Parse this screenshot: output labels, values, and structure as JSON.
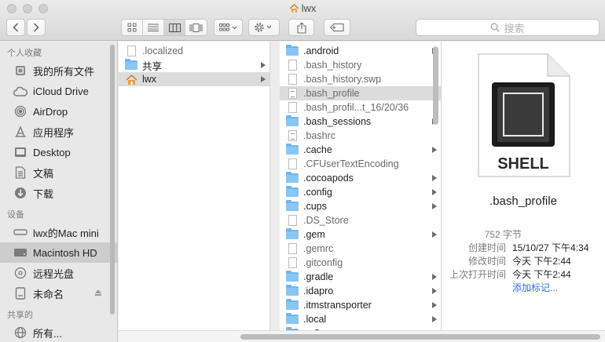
{
  "window": {
    "title": "lwx"
  },
  "toolbar": {
    "search_placeholder": "搜索"
  },
  "sidebar": {
    "sections": [
      {
        "heading": "个人收藏",
        "items": [
          {
            "label": "我的所有文件",
            "icon": "all-files-icon"
          },
          {
            "label": "iCloud Drive",
            "icon": "cloud-icon"
          },
          {
            "label": "AirDrop",
            "icon": "airdrop-icon"
          },
          {
            "label": "应用程序",
            "icon": "applications-icon"
          },
          {
            "label": "Desktop",
            "icon": "desktop-icon"
          },
          {
            "label": "文稿",
            "icon": "documents-icon"
          },
          {
            "label": "下载",
            "icon": "downloads-icon"
          }
        ]
      },
      {
        "heading": "设备",
        "items": [
          {
            "label": "lwx的Mac mini",
            "icon": "computer-icon"
          },
          {
            "label": "Macintosh HD",
            "icon": "harddisk-icon",
            "selected": true
          },
          {
            "label": "远程光盘",
            "icon": "disc-icon"
          },
          {
            "label": "未命名",
            "icon": "drive-icon",
            "eject": true
          }
        ]
      },
      {
        "heading": "共享的",
        "items": [
          {
            "label": "所有...",
            "icon": "network-icon"
          }
        ]
      }
    ]
  },
  "column1": [
    {
      "name": ".localized",
      "type": "doc"
    },
    {
      "name": "共享",
      "type": "folder",
      "arrow": true
    },
    {
      "name": "lwx",
      "type": "home",
      "arrow": true,
      "selected": true
    }
  ],
  "column2": [
    {
      "name": ".android",
      "type": "folder",
      "arrow": true
    },
    {
      "name": ".bash_history",
      "type": "doc"
    },
    {
      "name": ".bash_history.swp",
      "type": "doc"
    },
    {
      "name": ".bash_profile",
      "type": "txt",
      "selected": true
    },
    {
      "name": ".bash_profil...t_16/20/36",
      "type": "doc"
    },
    {
      "name": ".bash_sessions",
      "type": "folder",
      "arrow": true
    },
    {
      "name": ".bashrc",
      "type": "txt"
    },
    {
      "name": ".cache",
      "type": "folder",
      "arrow": true
    },
    {
      "name": ".CFUserTextEncoding",
      "type": "doc"
    },
    {
      "name": ".cocoapods",
      "type": "folder",
      "arrow": true
    },
    {
      "name": ".config",
      "type": "folder",
      "arrow": true
    },
    {
      "name": ".cups",
      "type": "folder",
      "arrow": true
    },
    {
      "name": ".DS_Store",
      "type": "doc"
    },
    {
      "name": ".gem",
      "type": "folder",
      "arrow": true
    },
    {
      "name": ".gemrc",
      "type": "doc"
    },
    {
      "name": ".gitconfig",
      "type": "doc"
    },
    {
      "name": ".gradle",
      "type": "folder",
      "arrow": true
    },
    {
      "name": ".idapro",
      "type": "folder",
      "arrow": true
    },
    {
      "name": ".itmstransporter",
      "type": "folder",
      "arrow": true
    },
    {
      "name": ".local",
      "type": "folder",
      "arrow": true
    },
    {
      "name": ".m2",
      "type": "folder",
      "arrow": true
    }
  ],
  "preview": {
    "icon_text": "SHELL",
    "filename": ".bash_profile",
    "size": "752 字节",
    "created_label": "创建时间",
    "created_value": "15/10/27 下午4:34",
    "modified_label": "修改时间",
    "modified_value": "今天 下午2:44",
    "opened_label": "上次打开时间",
    "opened_value": "今天 下午2:44",
    "add_tags": "添加标记..."
  }
}
